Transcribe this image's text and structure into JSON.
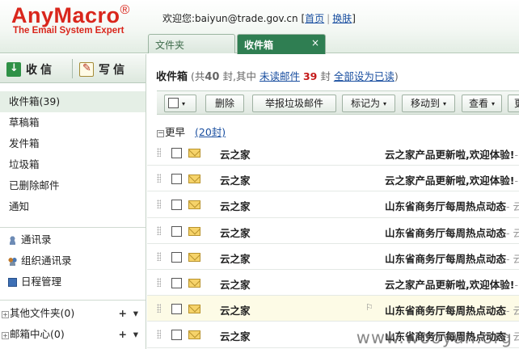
{
  "header": {
    "logo": "AnyMacro",
    "logo_mark": "®",
    "tagline": "The Email System Expert",
    "welcome": "欢迎您:baiyun@trade.gov.cn",
    "link_home": "首页",
    "link_skin": "换肤",
    "divider": "|"
  },
  "tabs": [
    {
      "label": "文件夹",
      "active": false
    },
    {
      "label": "收件箱",
      "active": true
    }
  ],
  "tab_close": "×",
  "sidebar": {
    "receive": "收信",
    "compose": "写信",
    "folders": [
      {
        "label": "收件箱(39)",
        "active": true
      },
      {
        "label": "草稿箱"
      },
      {
        "label": "发件箱"
      },
      {
        "label": "垃圾箱"
      },
      {
        "label": "已删除邮件"
      },
      {
        "label": "通知"
      }
    ],
    "tools": [
      {
        "label": "通讯录",
        "icon": "contacts-icon"
      },
      {
        "label": "组织通讯录",
        "icon": "org-contacts-icon"
      },
      {
        "label": "日程管理",
        "icon": "calendar-icon"
      }
    ],
    "groups": [
      {
        "label": "其他文件夹(0)",
        "add": "+",
        "menu": "▾"
      },
      {
        "label": "邮箱中心(0)",
        "add": "+",
        "menu": "▾"
      }
    ]
  },
  "main": {
    "title": "收件箱",
    "summary_prefix": "(共",
    "total": "40",
    "summary_mid": "封,其中",
    "unread_link": "未读邮件",
    "unread_count": "39",
    "summary_unit": "封",
    "mark_all_read": "全部设为已读",
    "summary_suffix": ")"
  },
  "toolbar": {
    "caret": "▾",
    "delete": "删除",
    "report_spam": "举报垃圾邮件",
    "mark_as": "标记为",
    "move_to": "移动到",
    "view": "查看",
    "more": "更多"
  },
  "group_header": {
    "toggle": "−",
    "label": "更早",
    "count": "(20封)"
  },
  "emails": [
    {
      "sender": "云之家",
      "subject": "云之家产品更新啦,欢迎体验!",
      "tail": "- 云之家"
    },
    {
      "sender": "云之家",
      "subject": "云之家产品更新啦,欢迎体验!",
      "tail": "- 云之家"
    },
    {
      "sender": "云之家",
      "subject": "山东省商务厅每周热点动态",
      "tail": "- 云之家"
    },
    {
      "sender": "云之家",
      "subject": "山东省商务厅每周热点动态",
      "tail": "- 云之家"
    },
    {
      "sender": "云之家",
      "subject": "山东省商务厅每周热点动态",
      "tail": "- 云之家"
    },
    {
      "sender": "云之家",
      "subject": "云之家产品更新啦,欢迎体验!",
      "tail": "- 云之家"
    },
    {
      "sender": "云之家",
      "subject": "山东省商务厅每周热点动态",
      "tail": "- 云之家",
      "highlight": true,
      "flag": "⚐"
    },
    {
      "sender": "云之家",
      "subject": "山东省商务厅每周热点动态",
      "tail": "- 云之家"
    }
  ],
  "watermark": "www.wooyun.org",
  "colors": {
    "brand_red": "#d9261c",
    "tab_active": "#2f7e52",
    "link": "#1a4fa0",
    "count_red": "#c41a1a"
  }
}
